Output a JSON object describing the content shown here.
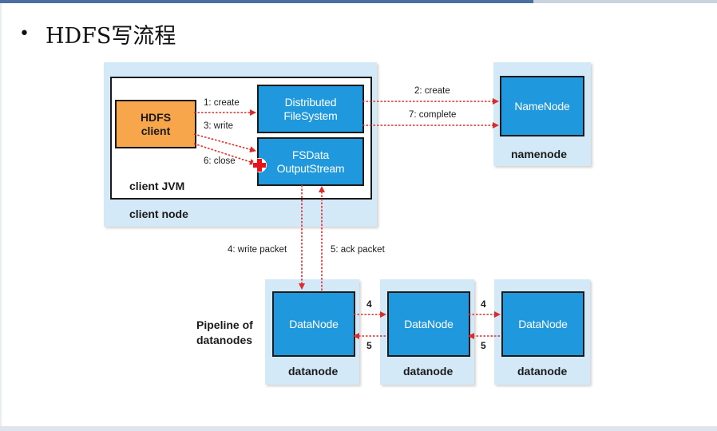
{
  "slide": {
    "bullet": "•",
    "title": "HDFS写流程"
  },
  "client_node": {
    "label": "client node",
    "jvm_label": "client JVM",
    "hdfs_client": [
      "HDFS",
      "client"
    ],
    "distributed_fs": [
      "Distributed",
      "FileSystem"
    ],
    "fsdata_stream": [
      "FSData",
      "OutputStream"
    ]
  },
  "namenode": {
    "box_label": "NameNode",
    "node_label": "namenode"
  },
  "arrows": {
    "create_1": "1: create",
    "write_3": "3: write",
    "close_6": "6: close",
    "create_2": "2: create",
    "complete_7": "7: complete",
    "write_packet_4": "4: write packet",
    "ack_packet_5": "5: ack packet",
    "pipe_forward": "4",
    "pipe_ack": "5"
  },
  "pipeline": {
    "label": [
      "Pipeline of",
      "datanodes"
    ],
    "datanodes": [
      {
        "box_label": "DataNode",
        "node_label": "datanode"
      },
      {
        "box_label": "DataNode",
        "node_label": "datanode"
      },
      {
        "box_label": "DataNode",
        "node_label": "datanode"
      }
    ]
  },
  "colors": {
    "panel": "#d3e9f7",
    "box_blue": "#1f98de",
    "client_orange": "#f7a64b",
    "arrow_red": "#e02a2a"
  }
}
